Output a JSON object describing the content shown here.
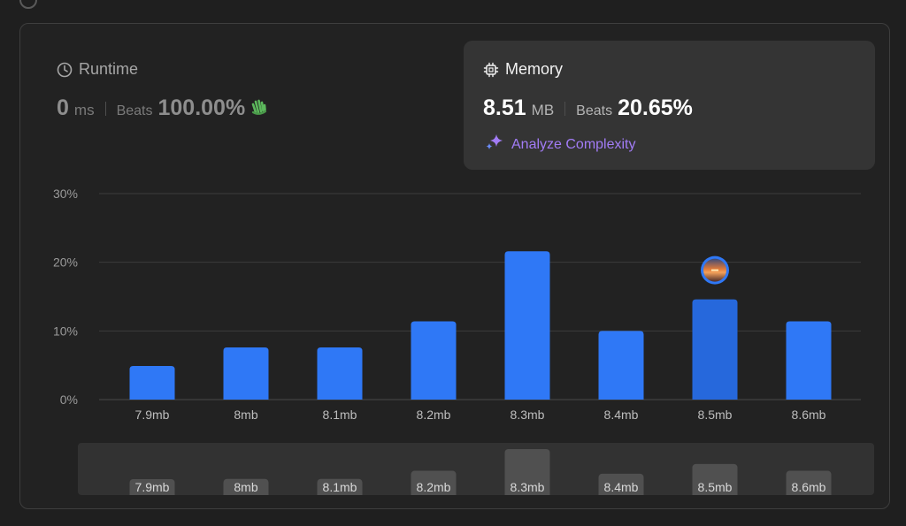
{
  "runtime": {
    "title": "Runtime",
    "value": "0",
    "unit": "ms",
    "beats_label": "Beats",
    "beats_pct": "100.00%"
  },
  "memory": {
    "title": "Memory",
    "value": "8.51",
    "unit": "MB",
    "beats_label": "Beats",
    "beats_pct": "20.65%",
    "analyze_label": "Analyze Complexity"
  },
  "icons": {
    "runtime": "clock-icon",
    "memory": "chip-icon",
    "runtime_badge": "waving-hand-icon",
    "analyze": "sparkle-icon",
    "user_marker": "avatar-icon"
  },
  "colors": {
    "bar": "#2f78f6",
    "bar_highlight": "#2668dc",
    "analyze": "#a27cf6",
    "wave": "#5cb85c"
  },
  "chart_data": {
    "type": "bar",
    "categories": [
      "7.9mb",
      "8mb",
      "8.1mb",
      "8.2mb",
      "8.3mb",
      "8.4mb",
      "8.5mb",
      "8.6mb"
    ],
    "values": [
      4.9,
      7.6,
      7.6,
      11.4,
      21.6,
      10.0,
      14.6,
      11.4
    ],
    "y_ticks": [
      "0%",
      "10%",
      "20%",
      "30%"
    ],
    "ylim": [
      0,
      30
    ],
    "grid": true,
    "highlight_category": "8.5mb",
    "title": "",
    "xlabel": "",
    "ylabel": ""
  }
}
